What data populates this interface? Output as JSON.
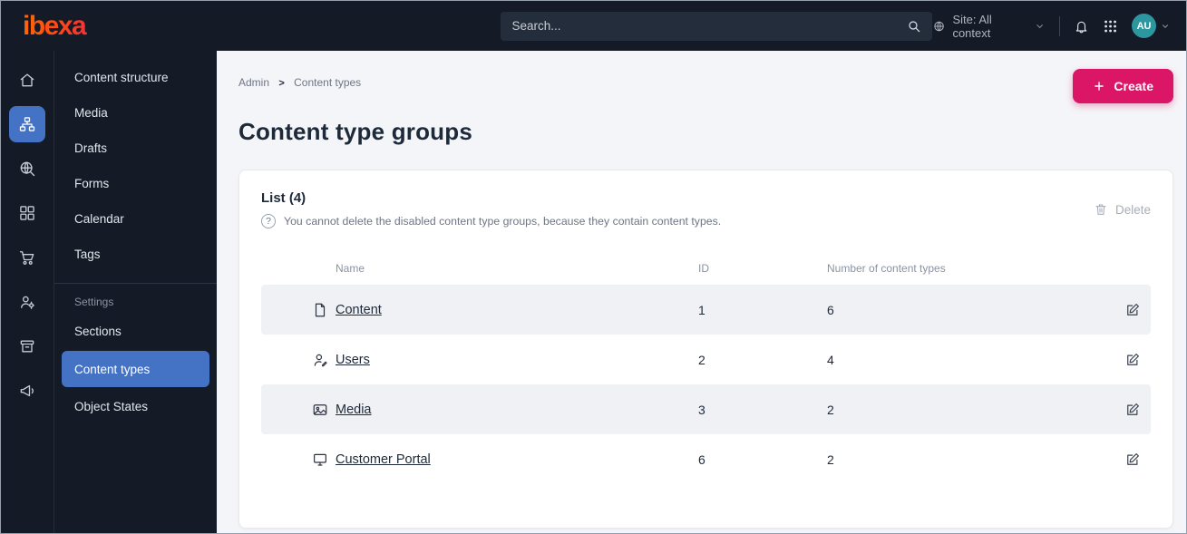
{
  "topbar": {
    "logo_text": "ibexa",
    "search_placeholder": "Search...",
    "site_context_label": "Site: All context",
    "avatar_initials": "AU",
    "icons": [
      "search-icon",
      "globe-icon",
      "chevron-down-icon",
      "bell-icon",
      "apps-grid-icon"
    ]
  },
  "rail": {
    "icons": [
      "home",
      "content-structure",
      "search-globe",
      "page-builder",
      "commerce-cart",
      "users",
      "admin",
      "marketing-megaphone"
    ],
    "active_icon": "content-structure"
  },
  "sidebar": {
    "items": [
      "Content structure",
      "Media",
      "Drafts",
      "Forms",
      "Calendar",
      "Tags"
    ],
    "settings_label": "Settings",
    "settings_items": [
      "Sections",
      "Content types",
      "Object States"
    ],
    "active_item": "Content types"
  },
  "main": {
    "breadcrumb": {
      "items": [
        "Admin",
        "Content types"
      ],
      "separator": ">"
    },
    "create_button": "Create",
    "page_title": "Content type groups",
    "card": {
      "list_title": "List (4)",
      "helper_icon": "?",
      "helper_text": "You cannot delete the disabled content type groups, because they contain content types.",
      "delete_button": "Delete",
      "table": {
        "columns": [
          "Name",
          "ID",
          "Number of content types"
        ],
        "rows": [
          {
            "icon": "content-file-icon",
            "name": "Content",
            "id": 1,
            "count": 6
          },
          {
            "icon": "user-edit-icon",
            "name": "Users",
            "id": 2,
            "count": 4
          },
          {
            "icon": "media-image-icon",
            "name": "Media",
            "id": 3,
            "count": 2
          },
          {
            "icon": "customer-portal-monitor-icon",
            "name": "Customer Portal",
            "id": 6,
            "count": 2
          }
        ]
      }
    }
  },
  "colors": {
    "topbar_bg": "#141b26",
    "active_blue": "#4472c4",
    "accent_pink": "#dc1666",
    "avatar_teal": "#2d97a0",
    "main_bg": "#f4f5f8",
    "zebra_row": "#f0f1f5",
    "text_dark": "#1e2a3a"
  }
}
